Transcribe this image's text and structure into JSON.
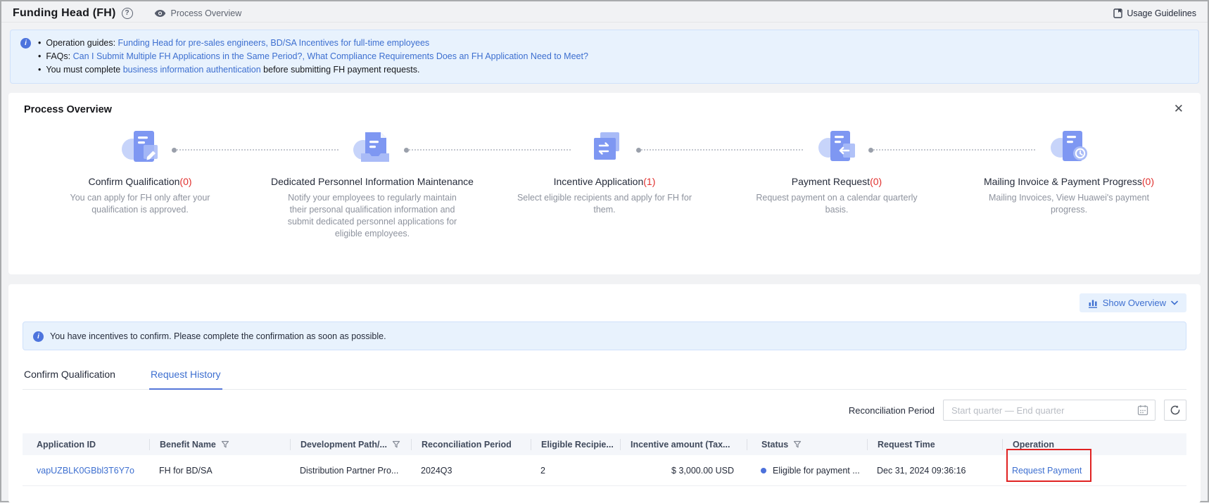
{
  "topbar": {
    "title": "Funding Head (FH)",
    "subtitle": "Process Overview",
    "usage_guidelines": "Usage Guidelines"
  },
  "guide_banner": {
    "line1_label": "Operation guides: ",
    "line1_link1": "Funding Head for pre-sales engineers",
    "line1_sep": ", ",
    "line1_link2": "BD/SA Incentives for full-time employees",
    "line2_label": "FAQs: ",
    "line2_link1": "Can I Submit Multiple FH Applications in the Same Period?",
    "line2_sep": ", ",
    "line2_link2": "What Compliance Requirements Does an FH Application Need to Meet?",
    "line3_pre": "You must complete ",
    "line3_link": "business information authentication",
    "line3_post": " before submitting FH payment requests."
  },
  "process": {
    "title": "Process Overview",
    "close_glyph": "✕",
    "steps": [
      {
        "name": "Confirm Qualification",
        "count": "(0)",
        "desc": "You can apply for FH only after your qualification is approved."
      },
      {
        "name": "Dedicated Personnel Information Maintenance",
        "count": "",
        "desc": "Notify your employees to regularly maintain their personal qualification information and submit dedicated personnel applications for eligible employees."
      },
      {
        "name": "Incentive Application",
        "count": "(1)",
        "desc": "Select eligible recipients and apply for FH for them."
      },
      {
        "name": "Payment Request",
        "count": "(0)",
        "desc": "Request payment on a calendar quarterly basis."
      },
      {
        "name": "Mailing Invoice & Payment Progress",
        "count": "(0)",
        "desc": "Mailing Invoices, View Huawei's payment progress."
      }
    ]
  },
  "toolbar": {
    "show_overview_label": "Show Overview"
  },
  "incentive_banner": {
    "text": "You have incentives to confirm. Please complete the confirmation as soon as possible."
  },
  "tabs": [
    {
      "label": "Confirm Qualification"
    },
    {
      "label": "Request History"
    }
  ],
  "filter": {
    "label": "Reconciliation Period",
    "placeholder": "Start quarter — End quarter"
  },
  "table": {
    "headers": [
      "Application ID",
      "Benefit Name",
      "Development Path/...",
      "Reconciliation Period",
      "Eligible Recipie...",
      "Incentive amount (Tax...",
      "Status",
      "Request Time",
      "Operation"
    ],
    "rows": [
      {
        "application_id": "vapUZBLK0GBbl3T6Y7o",
        "benefit_name": "FH for BD/SA",
        "development_path": "Distribution Partner Pro...",
        "reconciliation_period": "2024Q3",
        "eligible_recipients": "2",
        "incentive_amount": "$ 3,000.00 USD",
        "status": "Eligible for payment ...",
        "request_time": "Dec 31, 2024 09:36:16",
        "operation": "Request Payment"
      }
    ]
  },
  "colors": {
    "link_blue": "#3D6FD0",
    "count_red": "#E0302E",
    "annotation_red": "#E02222",
    "banner_bg": "#E8F2FD",
    "status_dot": "#4D71DB",
    "table_header_bg": "#F4F6FA"
  }
}
